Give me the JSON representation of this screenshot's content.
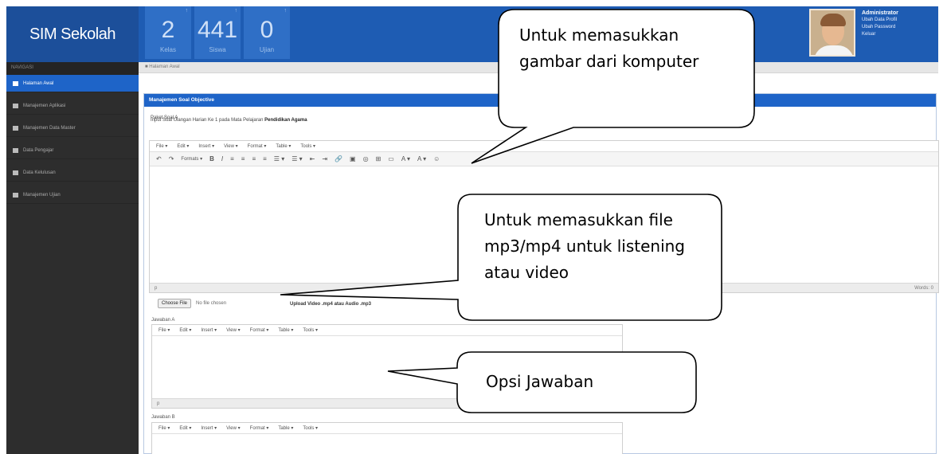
{
  "header": {
    "brand": "SIM Sekolah",
    "stats": [
      {
        "value": "2",
        "label": "Kelas",
        "corner": "↑"
      },
      {
        "value": "441",
        "label": "Siswa",
        "corner": "↑"
      },
      {
        "value": "0",
        "label": "Ujian",
        "corner": "↑"
      }
    ],
    "user": {
      "name": "Administrator",
      "links": [
        "Ubah Data Profil",
        "Ubah Password",
        "Keluar"
      ]
    }
  },
  "sidebar": {
    "heading": "NAVIGASI",
    "items": [
      {
        "label": "Halaman Awal",
        "active": true
      },
      {
        "label": "Manajemen Aplikasi",
        "active": false
      },
      {
        "label": "Manajemen Data Master",
        "active": false
      },
      {
        "label": "Data Pengajar",
        "active": false
      },
      {
        "label": "Data Kelulusan",
        "active": false
      },
      {
        "label": "Manajemen Ujian",
        "active": false
      }
    ]
  },
  "breadcrumb": "Halaman Awal",
  "panel": {
    "title": "Manajemen Soal Objective",
    "paket_label": "Paket Soal A",
    "info_prefix": "Input Soal Ulangan Harian Ke 1 pada Mata Pelajaran",
    "info_subject": "Pendidikan Agama",
    "menubar": [
      "File ▾",
      "Edit ▾",
      "Insert ▾",
      "View ▾",
      "Format ▾",
      "Table ▾",
      "Tools ▾"
    ],
    "toolbar": [
      "↶",
      "↷",
      "Formats ▾",
      "B",
      "I",
      "≡",
      "≡",
      "≡",
      "≡",
      "☰ ▾",
      "☰ ▾",
      "⇤",
      "⇥",
      "🔗",
      "▣",
      "◎",
      "⊞",
      "▭",
      "A ▾",
      "A ▾",
      "☺"
    ],
    "status_left": "p",
    "status_right": "Words: 0",
    "choose_file": "Choose File",
    "no_file": "No file chosen",
    "upload_note": "Upload Video .mp4 atau Audio .mp3",
    "jawaban_a": "Jawaban A",
    "jawaban_b": "Jawaban B"
  },
  "callouts": {
    "gambar": "Untuk memasukkan gambar dari komputer",
    "file": "Untuk memasukkan file mp3/mp4 untuk listening atau video",
    "opsi": "Opsi Jawaban"
  }
}
